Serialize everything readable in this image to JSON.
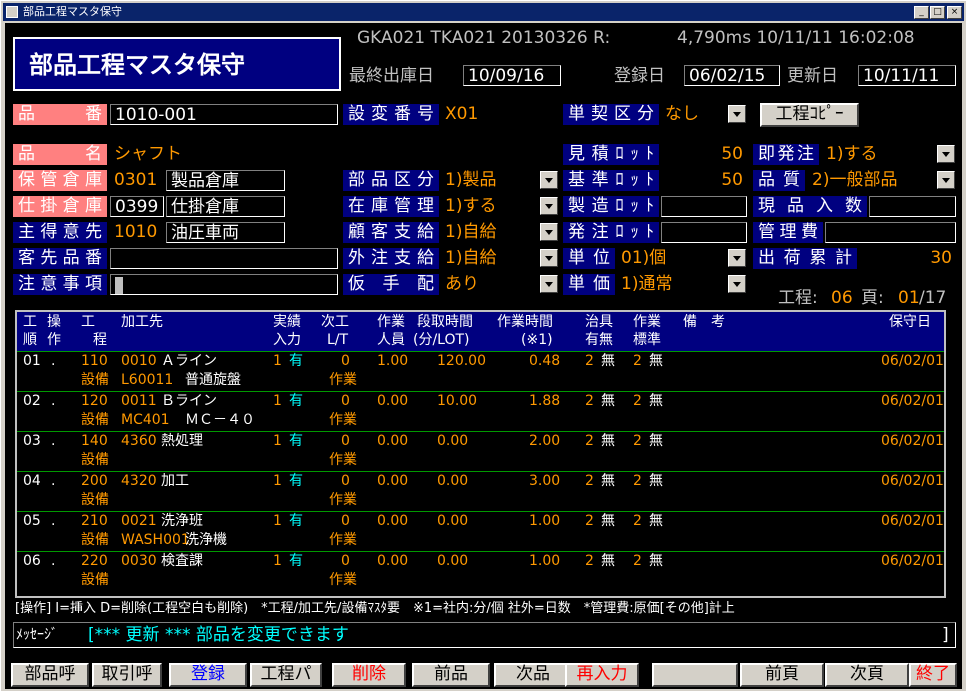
{
  "window": {
    "title": "部品工程マスタ保守"
  },
  "header": {
    "title": "部品工程マスタ保守",
    "status": "GKA021 TKA021 20130326 R:",
    "timing": "4,790ms 10/11/11 16:02:08",
    "last_out_label": "最終出庫日",
    "last_out": "10/09/16",
    "reg_label": "登録日",
    "reg": "06/02/15",
    "upd_label": "更新日",
    "upd": "10/11/11"
  },
  "form": {
    "hinban_label": "品番",
    "hinban": "1010-001",
    "sethen_label": "設変番号",
    "sethen": "X01",
    "tankei_label": "単契区分",
    "tankei": "なし",
    "copy_btn": "工程ｺﾋﾟｰ",
    "hinmei_label": "品名",
    "hinmei": "シャフト",
    "mitsumori_label": "見積ﾛｯﾄ",
    "mitsumori": "50",
    "sokuhatchu_label": "即発注",
    "sokuhatchu": "1)する",
    "hokan_label": "保管倉庫",
    "hokan_code": "0301",
    "hokan_name": "製品倉庫",
    "buhin_label": "部品区分",
    "buhin": "1)製品",
    "kijun_label": "基準ﾛｯﾄ",
    "kijun": "50",
    "hinshitsu_label": "品質",
    "hinshitsu": "2)一般部品",
    "shikake_label": "仕掛倉庫",
    "shikake_code": "0399",
    "shikake_name": "仕掛倉庫",
    "zaiko_label": "在庫管理",
    "zaiko": "1)する",
    "seizo_label": "製造ﾛｯﾄ",
    "seizo": "",
    "genpin_label": "現品入数",
    "genpin": "",
    "tokui_label": "主得意先",
    "tokui_code": "1010",
    "tokui_name": "油圧車両",
    "kokyaku_label": "顧客支給",
    "kokyaku": "1)自給",
    "hatchu_label": "発注ﾛｯﾄ",
    "hatchu": "",
    "kanri_label": "管理費",
    "kanri": "",
    "kyakusaki_label": "客先品番",
    "kyakusaki": "",
    "gaichu_label": "外注支給",
    "gaichu": "1)自給",
    "tani_label": "単位",
    "tani": "01)個",
    "shukka_label": "出荷累計",
    "shukka": "30",
    "chui_label": "注意事項",
    "chui": "",
    "karitehai_label": "仮手配",
    "karitehai": "あり",
    "tanka_label": "単価",
    "tanka": "1)通常",
    "koutei_label": "工程:",
    "koutei": "06",
    "page_label": "頁:",
    "page": "01",
    "page_total": "/17"
  },
  "grid": {
    "headers": {
      "h1a": "工",
      "h1b": "順",
      "h2a": "操",
      "h2b": "作",
      "h3a": "工",
      "h3b": "程",
      "h4": "加工先",
      "h5a": "実績",
      "h5b": "入力",
      "h6a": "次工",
      "h6b": "L/T",
      "h7a": "作業",
      "h7b": "人員",
      "h8a": "段取時間",
      "h8b": "(分/LOT)",
      "h9a": "作業時間",
      "h9b": "(※1)",
      "h10a": "治具",
      "h10b": "有無",
      "h11a": "作業",
      "h11b": "標準",
      "h12": "備　考",
      "h13": "保守日"
    },
    "rows": [
      {
        "no": "01",
        "op": ".",
        "proc": "110",
        "code": "0010",
        "name": "Ａライン",
        "jis": "1",
        "jisl": "有",
        "lt": "0",
        "nin": "1.00",
        "dan": "120.00",
        "saku": "0.48",
        "jig": "2",
        "jigl": "無",
        "std": "2",
        "stdl": "無",
        "date": "06/02/01",
        "setsubi": "設備",
        "scode": "L60011",
        "sname": "普通旋盤",
        "sagyo": "作業"
      },
      {
        "no": "02",
        "op": ".",
        "proc": "120",
        "code": "0011",
        "name": "Ｂライン",
        "jis": "1",
        "jisl": "有",
        "lt": "0",
        "nin": "0.00",
        "dan": "10.00",
        "saku": "1.88",
        "jig": "2",
        "jigl": "無",
        "std": "2",
        "stdl": "無",
        "date": "06/02/01",
        "setsubi": "設備",
        "scode": "MC401",
        "sname": "ＭＣ－４０",
        "sagyo": "作業"
      },
      {
        "no": "03",
        "op": ".",
        "proc": "140",
        "code": "4360",
        "name": "熱処理",
        "jis": "1",
        "jisl": "有",
        "lt": "0",
        "nin": "0.00",
        "dan": "0.00",
        "saku": "2.00",
        "jig": "2",
        "jigl": "無",
        "std": "2",
        "stdl": "無",
        "date": "06/02/01",
        "setsubi": "設備",
        "scode": "",
        "sname": "",
        "sagyo": "作業"
      },
      {
        "no": "04",
        "op": ".",
        "proc": "200",
        "code": "4320",
        "name": "加工",
        "jis": "1",
        "jisl": "有",
        "lt": "0",
        "nin": "0.00",
        "dan": "0.00",
        "saku": "3.00",
        "jig": "2",
        "jigl": "無",
        "std": "2",
        "stdl": "無",
        "date": "06/02/01",
        "setsubi": "設備",
        "scode": "",
        "sname": "",
        "sagyo": "作業"
      },
      {
        "no": "05",
        "op": ".",
        "proc": "210",
        "code": "0021",
        "name": "洗浄班",
        "jis": "1",
        "jisl": "有",
        "lt": "0",
        "nin": "0.00",
        "dan": "0.00",
        "saku": "1.00",
        "jig": "2",
        "jigl": "無",
        "std": "2",
        "stdl": "無",
        "date": "06/02/01",
        "setsubi": "設備",
        "scode": "WASH001",
        "sname": "洗浄機",
        "sagyo": "作業"
      },
      {
        "no": "06",
        "op": ".",
        "proc": "220",
        "code": "0030",
        "name": "検査課",
        "jis": "1",
        "jisl": "有",
        "lt": "0",
        "nin": "0.00",
        "dan": "0.00",
        "saku": "1.00",
        "jig": "2",
        "jigl": "無",
        "std": "2",
        "stdl": "無",
        "date": "06/02/01",
        "setsubi": "設備",
        "scode": "",
        "sname": "",
        "sagyo": "作業"
      }
    ]
  },
  "footer": {
    "help": "[操作] I=挿入 D=削除(工程空白も削除)　*工程/加工先/設備ﾏｽﾀ要　※1=社内:分/個 社外=日数　*管理費:原価[その他]計上",
    "msg_label": "ﾒｯｾｰｼﾞ",
    "msg": "[*** 更新 *** 部品を変更できます",
    "msg_end": "]",
    "keys": [
      "部品呼",
      "取引呼",
      "登録",
      "工程パ",
      "削除",
      "前品",
      "次品",
      "再入力",
      "",
      "前頁",
      "次頁",
      "終了"
    ]
  }
}
